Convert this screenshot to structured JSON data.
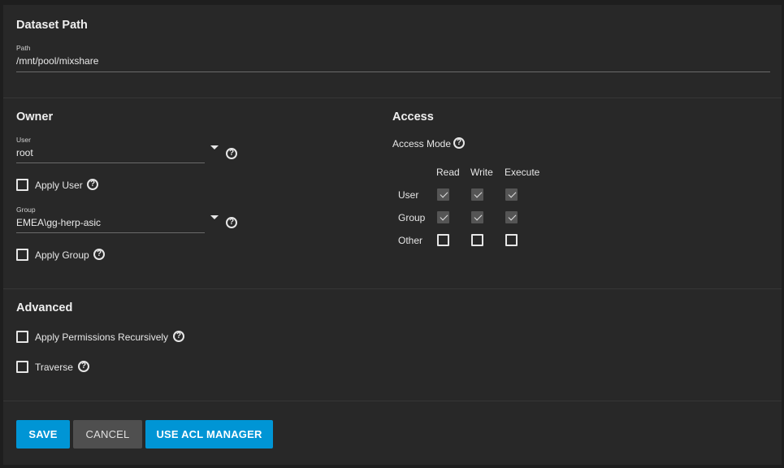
{
  "dataset": {
    "title": "Dataset Path",
    "path_label": "Path",
    "path_value": "/mnt/pool/mixshare"
  },
  "owner": {
    "title": "Owner",
    "user_label": "User",
    "user_value": "root",
    "apply_user_label": "Apply User",
    "group_label": "Group",
    "group_value": "EMEA\\gg-herp-asic",
    "apply_group_label": "Apply Group"
  },
  "access": {
    "title": "Access",
    "mode_label": "Access Mode",
    "columns": [
      "Read",
      "Write",
      "Execute"
    ],
    "rows": [
      {
        "label": "User",
        "values": [
          true,
          true,
          true
        ]
      },
      {
        "label": "Group",
        "values": [
          true,
          true,
          true
        ]
      },
      {
        "label": "Other",
        "values": [
          false,
          false,
          false
        ]
      }
    ]
  },
  "advanced": {
    "title": "Advanced",
    "recursive_label": "Apply Permissions Recursively",
    "traverse_label": "Traverse"
  },
  "actions": {
    "save": "SAVE",
    "cancel": "CANCEL",
    "acl_manager": "USE ACL MANAGER"
  },
  "colors": {
    "primary": "#0095d5",
    "background": "#282828",
    "secondary_button": "#4f4f4f"
  },
  "icons": {
    "help": "help-circle-icon",
    "dropdown": "caret-down-icon",
    "check": "check-icon"
  }
}
